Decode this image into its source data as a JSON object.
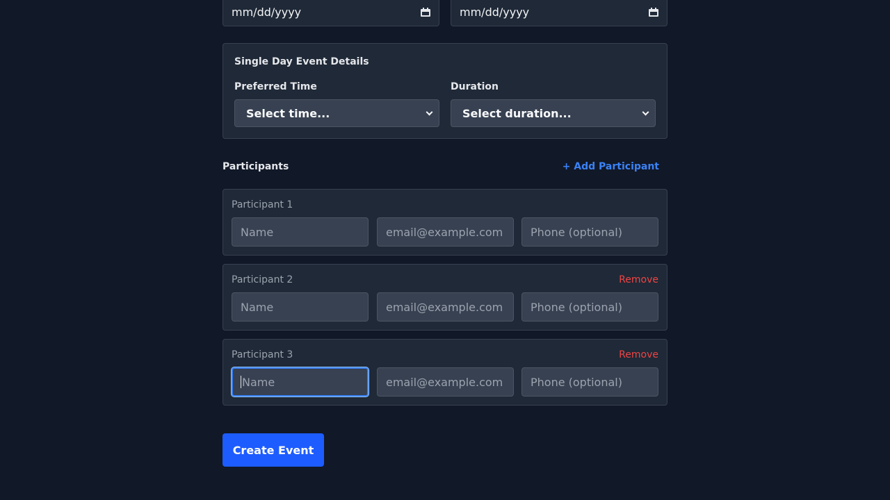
{
  "dates": {
    "start_placeholder": "mm/dd/yyyy",
    "end_placeholder": "mm/dd/yyyy",
    "icon": "calendar-icon"
  },
  "single_day": {
    "title": "Single Day Event Details",
    "time_label": "Preferred Time",
    "time_value": "Select time...",
    "duration_label": "Duration",
    "duration_value": "Select duration..."
  },
  "participants": {
    "title": "Participants",
    "add_label": "+ Add Participant",
    "remove_label": "Remove",
    "items": [
      {
        "label": "Participant 1",
        "name_placeholder": "Name",
        "email_placeholder": "email@example.com",
        "phone_placeholder": "Phone (optional)"
      },
      {
        "label": "Participant 2",
        "name_placeholder": "Name",
        "email_placeholder": "email@example.com",
        "phone_placeholder": "Phone (optional)"
      },
      {
        "label": "Participant 3",
        "name_placeholder": "Name",
        "email_placeholder": "email@example.com",
        "phone_placeholder": "Phone (optional)"
      }
    ]
  },
  "submit_label": "Create Event",
  "colors": {
    "background": "#111827",
    "panel": "#1f2937",
    "accent": "#1d5cff",
    "link": "#3b82f6",
    "danger": "#ef4444"
  }
}
